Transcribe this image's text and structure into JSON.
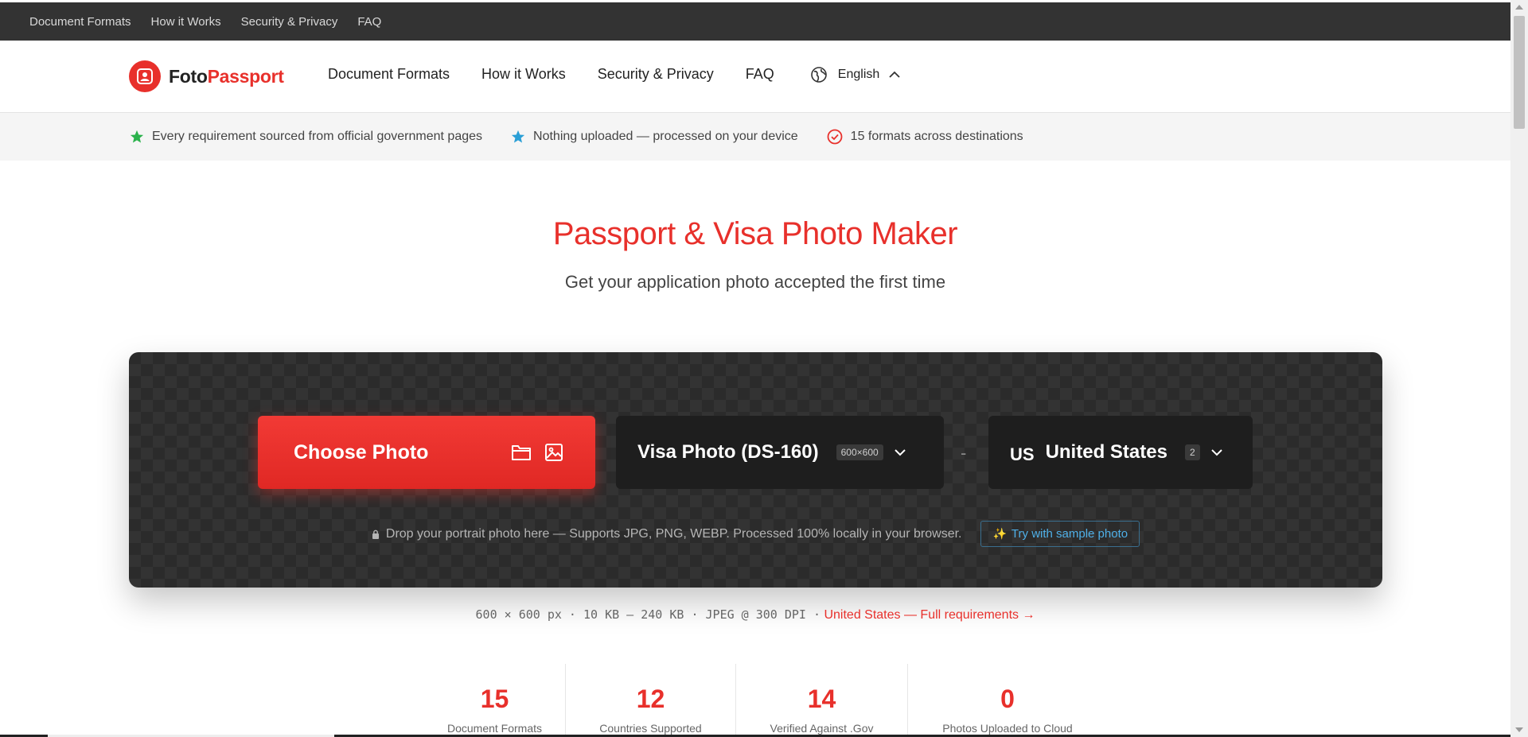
{
  "topbar": {
    "links": [
      "Document Formats",
      "How it Works",
      "Security & Privacy",
      "FAQ"
    ]
  },
  "header": {
    "logo_foto": "Foto",
    "logo_passport": "Passport",
    "nav": [
      "Document Formats",
      "How it Works",
      "Security & Privacy",
      "FAQ"
    ],
    "language": "English"
  },
  "trust": {
    "items": [
      {
        "icon": "star-icon",
        "color": "#2bb24c",
        "text": "Every requirement sourced from official government pages"
      },
      {
        "icon": "star-icon",
        "color": "#2a9fd6",
        "text": "Nothing uploaded — processed on your device"
      },
      {
        "icon": "check-circle-icon",
        "color": "#e8302b",
        "text": "15 formats across destinations"
      }
    ]
  },
  "hero": {
    "title": "Passport & Visa Photo Maker",
    "subtitle": "Get your application photo accepted the first time"
  },
  "panel": {
    "choose_label": "Choose Photo",
    "format": {
      "label": "Visa Photo (DS-160)",
      "badge": "600×600"
    },
    "separator": "-",
    "country": {
      "code": "US",
      "label": "United States",
      "badge": "2"
    },
    "drop_text": "Drop your portrait photo here — Supports JPG, PNG, WEBP. Processed 100% locally in your browser.",
    "sample_label": "Try with sample photo"
  },
  "spec": {
    "text": "600 × 600 px · 10 KB – 240 KB · JPEG @ 300 DPI ·",
    "link": "United States — Full requirements →"
  },
  "stats": [
    {
      "num": "15",
      "label": "Document Formats"
    },
    {
      "num": "12",
      "label": "Countries Supported"
    },
    {
      "num": "14",
      "label": "Verified Against .Gov"
    },
    {
      "num": "0",
      "label": "Photos Uploaded to Cloud"
    }
  ],
  "colors": {
    "accent": "#e8302b",
    "dark": "#333333",
    "panel": "#2b2b2b"
  }
}
